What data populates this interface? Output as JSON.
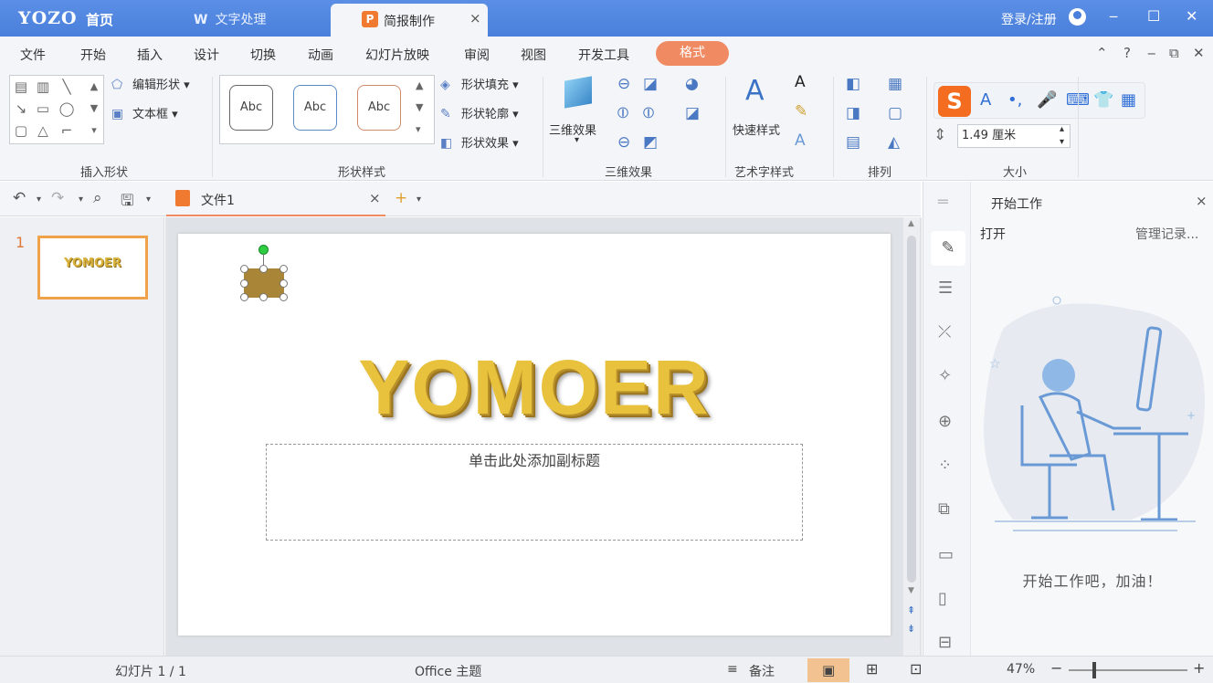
{
  "titlebar": {
    "logo": "YOZO",
    "home": "首页",
    "tab_wps": "文字处理",
    "tab_wps_icon": "W",
    "tab_active": "简报制作",
    "tab_active_icon": "P",
    "close_tab": "×",
    "login": "登录/注册",
    "minimize": "‒",
    "maximize": "☐",
    "close": "✕"
  },
  "menu": {
    "items": [
      "文件",
      "开始",
      "插入",
      "设计",
      "切换",
      "动画",
      "幻灯片放映",
      "审阅",
      "视图",
      "开发工具"
    ],
    "active": "格式",
    "right_tools": [
      "⌃",
      "?",
      "‒",
      "⧉",
      "✕"
    ]
  },
  "ribbon": {
    "insert_shape": {
      "label": "插入形状",
      "edit_shape": "编辑形状",
      "textbox": "文本框"
    },
    "shape_style": {
      "label": "形状样式",
      "abc": [
        "Abc",
        "Abc",
        "Abc"
      ],
      "fill": "形状填充",
      "outline": "形状轮廓",
      "effect": "形状效果"
    },
    "three_d": {
      "label": "三维效果",
      "button": "三维效果"
    },
    "art": {
      "label": "艺术字样式",
      "quick": "快速样式"
    },
    "arrange": {
      "label": "排列"
    },
    "size": {
      "label": "大小",
      "value": "1.49 厘米"
    },
    "ime_icons": [
      "S",
      "A",
      "•,",
      "🎤",
      "⌨",
      "👕",
      "▦"
    ]
  },
  "qat": {
    "undo": "↶",
    "redo": "↷",
    "preview": "⌕",
    "save": "🖫",
    "doc_tab": "文件1",
    "doc_close": "×",
    "new": "+"
  },
  "thumbs": {
    "number": "1",
    "thumb_text": "YOMOER"
  },
  "slide": {
    "title": "YOMOER",
    "subtitle_placeholder": "单击此处添加副标题"
  },
  "taskpane": {
    "title": "开始工作",
    "close": "×",
    "open": "打开",
    "manage": "管理记录...",
    "message": "开始工作吧，加油！"
  },
  "status": {
    "slide_info": "幻灯片 1 / 1",
    "theme": "Office 主题",
    "notes": "备注",
    "zoom": "47%",
    "zoom_minus": "−",
    "zoom_plus": "+"
  },
  "colors": {
    "titlebar": "#4a7fdb",
    "accent_orange": "#ef8a62",
    "wordart_gold": "#e8c23c"
  }
}
